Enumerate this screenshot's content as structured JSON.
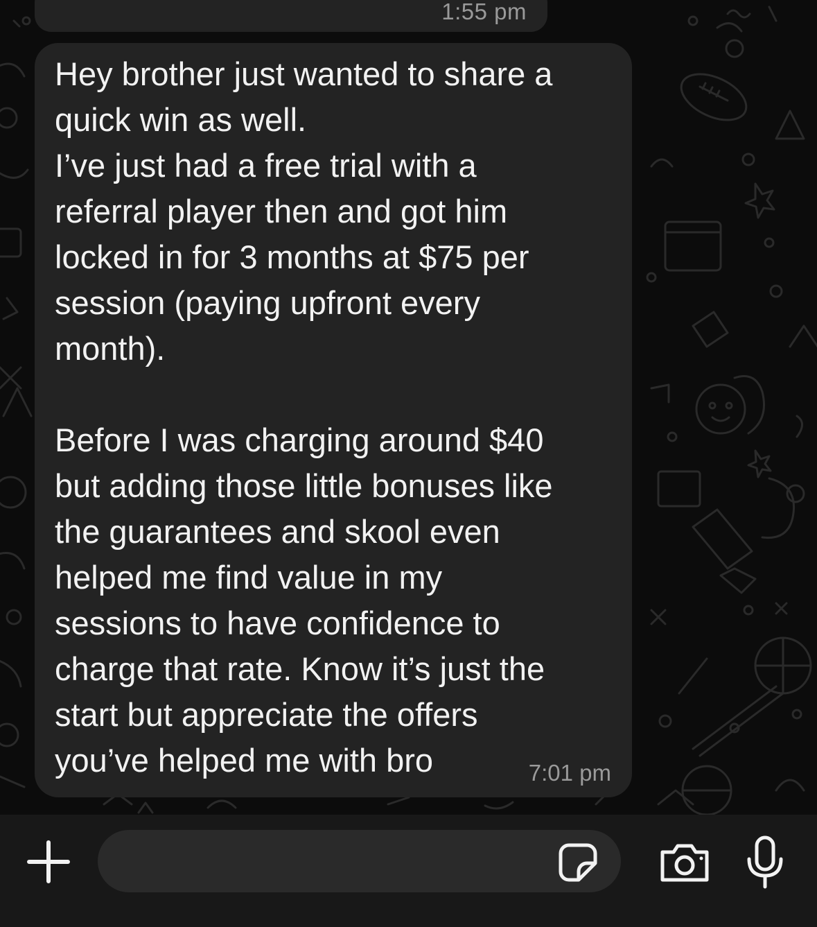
{
  "conversation": {
    "previous_message": {
      "time": "1:55 pm"
    },
    "current_message": {
      "text": "Hey brother just wanted to share a\nquick win as well.\nI’ve just had a free trial with a\nreferral player then and got him\nlocked in for 3 months at $75 per\nsession (paying upfront every\nmonth).\n\nBefore I was charging around $40\nbut adding those little bonuses like\nthe guarantees and skool even\nhelped me find value in my\nsessions to have confidence to\ncharge that rate. Know it’s just the\nstart but appreciate the offers\nyou’ve helped me with bro",
      "time": "7:01 pm"
    }
  },
  "composer": {
    "value": "",
    "icons": {
      "attach": "plus-icon",
      "sticker": "sticker-icon",
      "camera": "camera-icon",
      "voice": "microphone-icon"
    }
  },
  "colors": {
    "bubble": "#232323",
    "background": "#0c0c0c",
    "text": "#f2f2f2",
    "timestamp": "#9a9a9a",
    "input_bar": "#181818",
    "input_field": "#2a2a2a"
  }
}
